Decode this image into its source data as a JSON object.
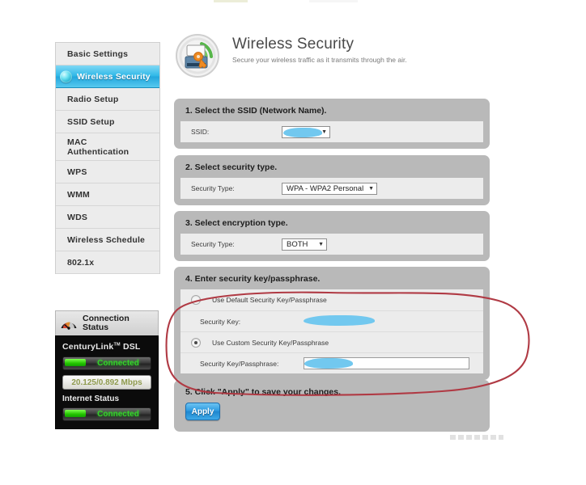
{
  "sidebar": {
    "items": [
      {
        "label": "Basic Settings",
        "active": false
      },
      {
        "label": "Wireless Security",
        "active": true
      },
      {
        "label": "Radio Setup",
        "active": false
      },
      {
        "label": "SSID Setup",
        "active": false
      },
      {
        "label": "MAC Authentication",
        "active": false
      },
      {
        "label": "WPS",
        "active": false
      },
      {
        "label": "WMM",
        "active": false
      },
      {
        "label": "WDS",
        "active": false
      },
      {
        "label": "Wireless Schedule",
        "active": false
      },
      {
        "label": "802.1x",
        "active": false
      }
    ]
  },
  "connection_status": {
    "title": "Connection Status",
    "icon": "gauge-icon",
    "brand": "CenturyLink",
    "brand_tm": "TM",
    "brand_suffix": "DSL",
    "dsl_state": "Connected",
    "speed": "20.125/0.892 Mbps",
    "internet_label": "Internet Status",
    "internet_state": "Connected",
    "connected_color": "#35d22a"
  },
  "header": {
    "icon": "wireless-security-icon",
    "title": "Wireless Security",
    "subtitle": "Secure your wireless traffic as it transmits through the air."
  },
  "sections": {
    "ssid": {
      "title": "1. Select the SSID (Network Name).",
      "field_label": "SSID:",
      "value": "",
      "redacted": true
    },
    "security_type": {
      "title": "2. Select security type.",
      "field_label": "Security Type:",
      "value": "WPA - WPA2 Personal"
    },
    "encryption_type": {
      "title": "3. Select encryption type.",
      "field_label": "Security Type:",
      "value": "BOTH"
    },
    "security_key": {
      "title": "4. Enter security key/passphrase.",
      "default_option": "Use Default Security Key/Passphrase",
      "default_selected": false,
      "default_key_label": "Security Key:",
      "default_key_value": "",
      "custom_option": "Use Custom Security Key/Passphrase",
      "custom_selected": true,
      "custom_key_label": "Security Key/Passphrase:",
      "custom_key_value": ""
    },
    "apply": {
      "title": "5. Click \"Apply\" to save your changes.",
      "button_label": "Apply"
    }
  },
  "annotation": {
    "color": "#b03a44",
    "shape": "hand-drawn-ellipse",
    "target": "section-4-security-key"
  },
  "redaction_color": "#72c8ef"
}
